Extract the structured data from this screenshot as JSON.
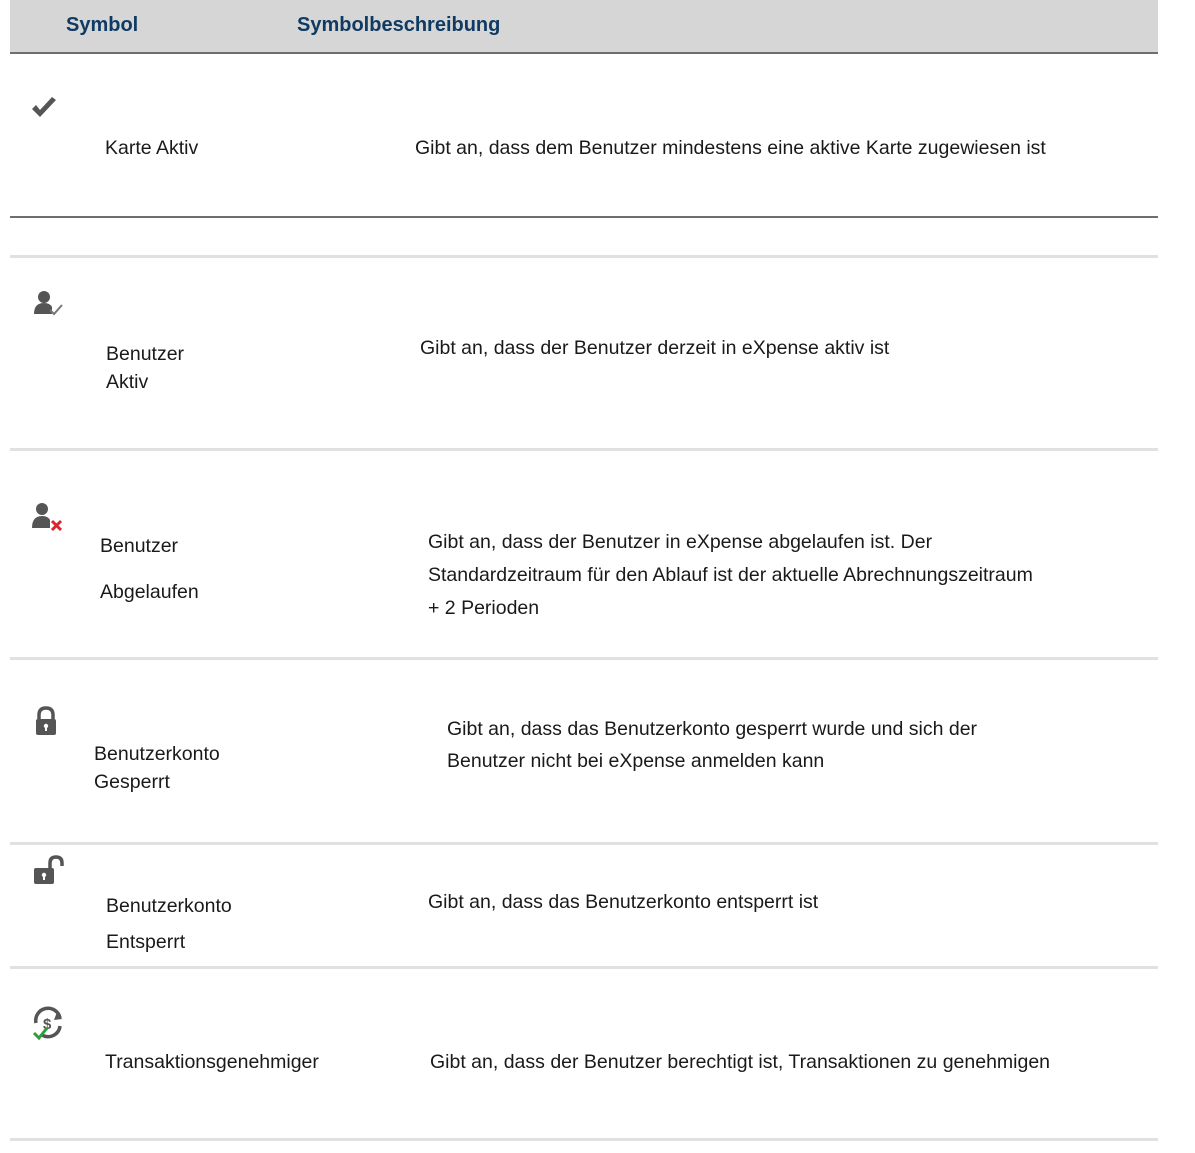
{
  "header": {
    "symbol_col": "Symbol",
    "description_col": "Symbolbeschreibung"
  },
  "rows": [
    {
      "icon": "checkmark-icon",
      "name_lines": [
        "Karte Aktiv"
      ],
      "desc_lines": [
        "Gibt an, dass dem Benutzer mindestens eine aktive Karte zugewiesen ist"
      ]
    },
    {
      "icon": "user-check-icon",
      "name_lines": [
        "Benutzer",
        "Aktiv"
      ],
      "desc_lines": [
        "Gibt an, dass der Benutzer derzeit in eXpense aktiv ist"
      ]
    },
    {
      "icon": "user-expired-icon",
      "name_lines": [
        "Benutzer",
        "Abgelaufen"
      ],
      "desc_lines": [
        "Gibt an, dass der Benutzer in eXpense abgelaufen ist. Der",
        "Standardzeitraum für den Ablauf ist der aktuelle Abrechnungszeitraum",
        "+ 2 Perioden"
      ]
    },
    {
      "icon": "lock-closed-icon",
      "name_lines": [
        "Benutzerkonto",
        "Gesperrt"
      ],
      "desc_lines": [
        "Gibt an, dass das Benutzerkonto gesperrt wurde und sich der",
        "Benutzer nicht bei eXpense anmelden kann"
      ]
    },
    {
      "icon": "lock-open-icon",
      "name_lines": [
        "Benutzerkonto",
        "Entsperrt"
      ],
      "desc_lines": [
        "Gibt an, dass das Benutzerkonto entsperrt ist"
      ]
    },
    {
      "icon": "transaction-approver-icon",
      "name_lines": [
        "Transaktionsgenehmiger"
      ],
      "desc_lines": [
        "Gibt an, dass der Benutzer berechtigt ist, Transaktionen zu genehmigen"
      ]
    }
  ],
  "colors": {
    "header_bg": "#d6d6d6",
    "header_text": "#0f3a63",
    "icon_gray": "#555555",
    "expired_red": "#d9252b",
    "approve_green": "#2e9d3c"
  }
}
